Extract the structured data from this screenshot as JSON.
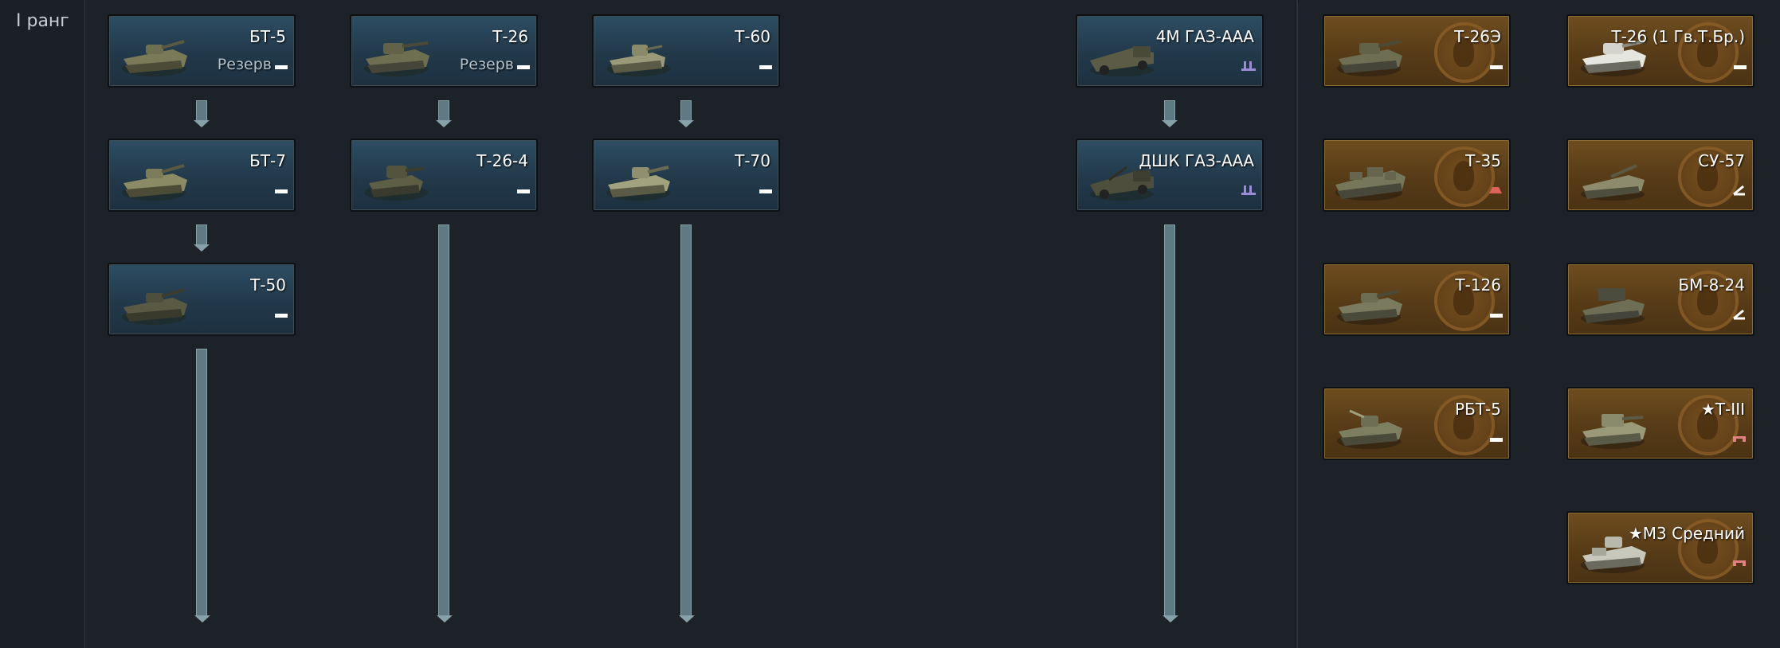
{
  "rank": {
    "label": "I ранг"
  },
  "tree": {
    "columns": [
      {
        "items": [
          {
            "name": "БТ-5",
            "status": "Резерв",
            "type": "light-tank-icon"
          },
          {
            "name": "БТ-7",
            "status": "",
            "type": "light-tank-icon"
          },
          {
            "name": "Т-50",
            "status": "",
            "type": "light-tank-icon"
          }
        ]
      },
      {
        "items": [
          {
            "name": "Т-26",
            "status": "Резерв",
            "type": "light-tank-icon"
          },
          {
            "name": "Т-26-4",
            "status": "",
            "type": "light-tank-icon"
          }
        ]
      },
      {
        "items": [
          {
            "name": "Т-60",
            "status": "",
            "type": "light-tank-icon"
          },
          {
            "name": "Т-70",
            "status": "",
            "type": "light-tank-icon"
          }
        ]
      },
      {
        "items": [
          {
            "name": "4М ГАЗ-ААА",
            "status": "",
            "type": "spaa-icon"
          },
          {
            "name": "ДШК ГАЗ-ААА",
            "status": "",
            "type": "spaa-icon"
          }
        ]
      }
    ]
  },
  "premium": {
    "col1": [
      {
        "name": "Т-26Э",
        "type": "light-tank-icon"
      },
      {
        "name": "Т-35",
        "type": "heavy-tank-icon"
      },
      {
        "name": "Т-126",
        "type": "light-tank-icon"
      },
      {
        "name": "РБТ-5",
        "type": "light-tank-icon"
      }
    ],
    "col2": [
      {
        "name": "Т-26 (1 Гв.Т.Бр.)",
        "type": "light-tank-icon"
      },
      {
        "name": "СУ-57",
        "type": "tank-destroyer-icon"
      },
      {
        "name": "БМ-8-24",
        "type": "tank-destroyer-icon"
      },
      {
        "name": "★Т-III",
        "type": "medium-tank-icon"
      },
      {
        "name": "★М3 Средний",
        "type": "medium-tank-icon"
      }
    ]
  },
  "colors": {
    "tech_card": "#2d4d63",
    "premium_card": "#6e4d1f",
    "arrow": "#5e7a82",
    "spaa_icon": "#9c8cd8",
    "heavy_icon": "#e0605a",
    "medium_icon": "#e08080"
  }
}
